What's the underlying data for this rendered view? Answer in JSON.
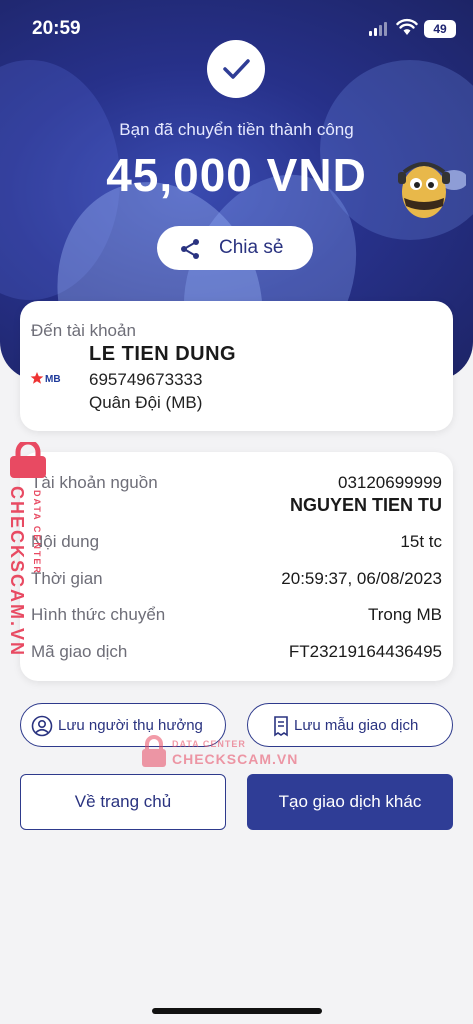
{
  "status_bar": {
    "time": "20:59",
    "battery": "49"
  },
  "hero": {
    "success_message": "Bạn đã chuyển tiền thành công",
    "amount": "45,000 VND",
    "share_label": "Chia sẻ"
  },
  "recipient": {
    "to_label": "Đến tài khoản",
    "bank_logo_text": "MB",
    "name": "LE TIEN DUNG",
    "account_number": "695749673333",
    "bank_name": "Quân Đội (MB)"
  },
  "details": {
    "source_label": "Tài khoản nguồn",
    "source_account": "03120699999",
    "source_name": "NGUYEN TIEN TU",
    "content_label": "Nội dung",
    "content_value": "15t tc",
    "time_label": "Thời gian",
    "time_value": "20:59:37, 06/08/2023",
    "method_label": "Hình thức chuyển",
    "method_value": "Trong MB",
    "code_label": "Mã giao dịch",
    "code_value": "FT23219164436495"
  },
  "actions": {
    "save_beneficiary": "Lưu người thụ hưởng",
    "save_template": "Lưu mẫu giao dịch",
    "home": "Về trang chủ",
    "new_transaction": "Tạo giao dịch khác"
  },
  "watermark": {
    "brand": "CHECKSCAM.VN",
    "sub": "DATA CENTER"
  },
  "colors": {
    "primary": "#2f3d96",
    "hero_bg": "#27318a",
    "watermark": "#e84a62"
  }
}
